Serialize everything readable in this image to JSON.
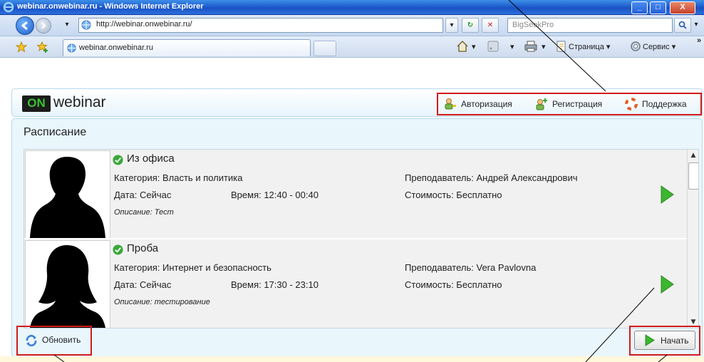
{
  "window": {
    "title": "webinar.onwebinar.ru - Windows Internet Explorer",
    "minimize": "_",
    "maximize": "□",
    "close": "X"
  },
  "addressbar": {
    "url": "http://webinar.onwebinar.ru/",
    "search_placeholder": "BigSeekPro"
  },
  "tabs": [
    {
      "label": "webinar.onwebinar.ru"
    }
  ],
  "command_bar": {
    "page": "Страница",
    "tools": "Сервис"
  },
  "site": {
    "logo_badge": "ON",
    "logo_text": "webinar",
    "links": {
      "auth": "Авторизация",
      "register": "Регистрация",
      "support": "Поддержка"
    }
  },
  "schedule": {
    "title": "Расписание",
    "items": [
      {
        "name": "Из офиса",
        "category": "Категория: Власть и политика",
        "date": "Дата: Сейчас",
        "time": "Время: 12:40 - 00:40",
        "teacher": "Преподаватель: Андрей Александрович",
        "price": "Стоимость: Бесплатно",
        "description": "Описание: Тест"
      },
      {
        "name": "Проба",
        "category": "Категория: Интернет и безопасность",
        "date": "Дата: Сейчас",
        "time": "Время: 17:30 - 23:10",
        "teacher": "Преподаватель: Vera Pavlovna",
        "price": "Стоимость: Бесплатно",
        "description": "Описание: тестирование"
      }
    ],
    "refresh_label": "Обновить",
    "start_label": "Начать"
  },
  "colors": {
    "highlight": "#d21b1b",
    "play_green": "#3cb52f",
    "panel_bg": "#e9f6fc"
  }
}
